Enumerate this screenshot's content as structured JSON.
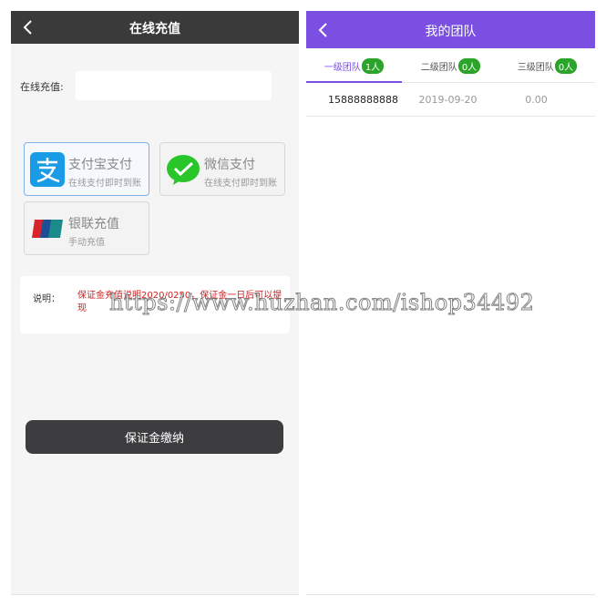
{
  "recharge": {
    "title": "在线充值",
    "amount_label": "在线充值:",
    "amount_value": "",
    "methods": [
      {
        "name": "支付宝支付",
        "sub": "在线支付即时到账",
        "icon": "alipay-icon",
        "color": "#1a9be6"
      },
      {
        "name": "微信支付",
        "sub": "在线支付即时到账",
        "icon": "wechat-icon",
        "color": "#28c628"
      },
      {
        "name": "银联充值",
        "sub": "手动充值",
        "icon": "unionpay-icon",
        "color": "#d8242a"
      }
    ],
    "note_label": "说明：",
    "note_text": "保证金充值说明2020/0250，保证金一日后可以提现",
    "button_label": "保证金缴纳"
  },
  "team": {
    "title": "我的团队",
    "tabs": [
      {
        "label": "一级团队",
        "count": "1人"
      },
      {
        "label": "二级团队",
        "count": "0人"
      },
      {
        "label": "三级团队",
        "count": "0人"
      }
    ],
    "rows": [
      {
        "phone": "15888888888",
        "date": "2019-09-20",
        "amount": "0.00"
      }
    ]
  },
  "watermark": "https://www.huzhan.com/ishop34492",
  "colors": {
    "dark_header": "#3a3a3a",
    "accent": "#7a4fe2",
    "badge": "#2aa52a",
    "note_text": "#d02020"
  }
}
